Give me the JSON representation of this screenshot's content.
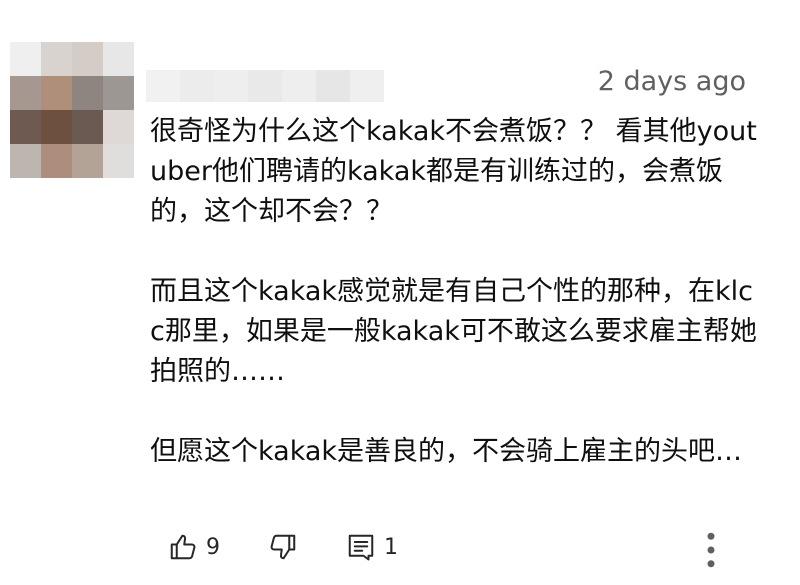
{
  "comment": {
    "timestamp": "2 days ago",
    "paragraphs": [
      "很奇怪为什么这个kakak不会煮饭？？ 看其他youtuber他们聘请的kakak都是有训练过的，会煮饭的，这个却不会？？",
      "而且这个kakak感觉就是有自己个性的那种，在klcc那里，如果是一般kakak可不敢这么要求雇主帮她拍照的……",
      "但愿这个kakak是善良的，不会骑上雇主的头吧…"
    ],
    "like_count": "9",
    "reply_count": "1"
  },
  "avatar": {
    "pixel_colors": [
      "#efefef",
      "#d9d3cf",
      "#d4ccc7",
      "#e7e7e7",
      "#a69891",
      "#b08f7a",
      "#8f8580",
      "#9d9794",
      "#6e5a50",
      "#6d503f",
      "#6b5a52",
      "#ded9d6",
      "#bdb5b0",
      "#ad8e7e",
      "#b3a296",
      "#dfdedd"
    ]
  },
  "username_blur": {
    "segment_colors": [
      "#f1f1f1",
      "#ececec",
      "#eeeeee",
      "#e9e9e9",
      "#eeeeee",
      "#e6e6e6",
      "#efefef"
    ]
  },
  "colors": {
    "text": "#0f0f0f",
    "secondary_text": "#606060",
    "icon": "#272727"
  },
  "icons": {
    "like": "thumbs-up-icon",
    "dislike": "thumbs-down-icon",
    "reply": "reply-comment-icon",
    "more": "more-vertical-icon"
  }
}
